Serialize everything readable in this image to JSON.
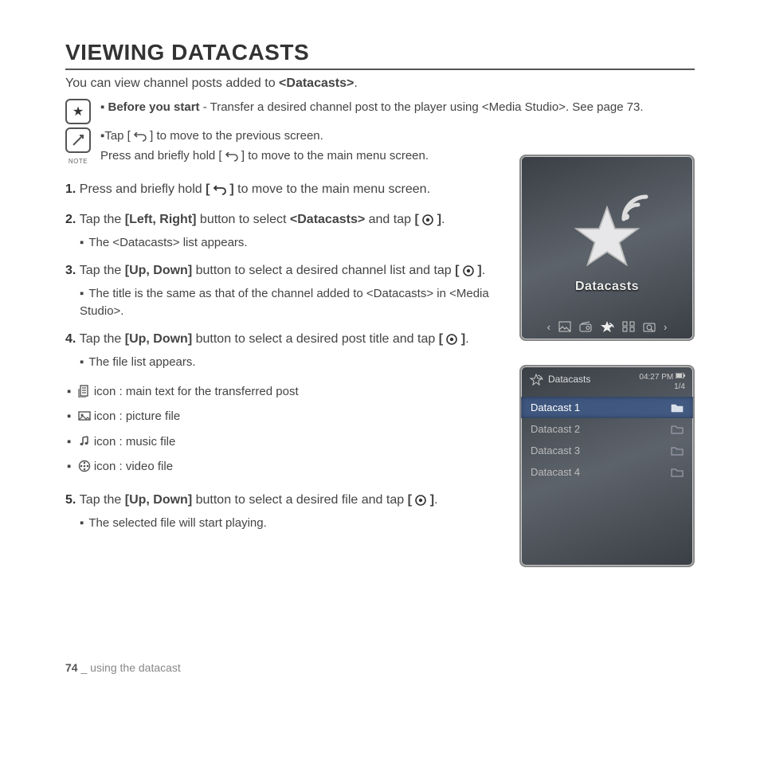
{
  "title": "VIEWING DATACASTS",
  "intro_pre": "You can view channel posts added to ",
  "intro_bold": "<Datacasts>",
  "intro_post": ".",
  "star_callout_bold": "Before you start",
  "star_callout_rest": " - Transfer a desired channel post to the player using <Media Studio>. See page 73.",
  "note_label": "NOTE",
  "note_line1_pre": "Tap [ ",
  "note_line1_post": " ] to move to the previous screen.",
  "note_line2_pre": "Press and briefly hold [ ",
  "note_line2_post": " ] to move to the main menu screen.",
  "steps": {
    "s1_pre": "Press and briefly hold ",
    "s1_b1": "[ ",
    "s1_b2": " ]",
    "s1_post": " to move to the main menu screen.",
    "s2_pre": "Tap the ",
    "s2_b1": "[Left, Right]",
    "s2_mid": " button to select ",
    "s2_b2": "<Datacasts>",
    "s2_mid2": " and tap ",
    "s2_b3": "[ ",
    "s2_b4": " ]",
    "s2_post": ".",
    "s2_sub": "The <Datacasts> list appears.",
    "s3_pre": "Tap the ",
    "s3_b1": "[Up, Down]",
    "s3_mid": " button to select a desired channel list and tap ",
    "s3_b2": "[ ",
    "s3_b3": " ]",
    "s3_post": ".",
    "s3_sub": "The title is the same as that of the channel added to <Datacasts> in <Media Studio>.",
    "s4_pre": "Tap the ",
    "s4_b1": "[Up, Down]",
    "s4_mid": " button to select a desired post title and tap ",
    "s4_b2": "[ ",
    "s4_b3": " ]",
    "s4_post": ".",
    "s4_sub": "The file list appears.",
    "s5_pre": "Tap the ",
    "s5_b1": "[Up, Down]",
    "s5_mid": " button to select a desired file and tap ",
    "s5_b2": "[ ",
    "s5_b3": " ]",
    "s5_post": ".",
    "s5_sub": "The selected file will start playing."
  },
  "legend": {
    "text": " icon : main text for the transferred post",
    "pic": " icon : picture file",
    "music": " icon : music file",
    "video": " icon : video file"
  },
  "screen1": {
    "label": "Datacasts"
  },
  "screen2": {
    "title": "Datacasts",
    "time": "04:27 PM",
    "page": "1/4",
    "items": [
      "Datacast 1",
      "Datacast 2",
      "Datacast 3",
      "Datacast 4"
    ]
  },
  "footer_page": "74",
  "footer_sep": " _ ",
  "footer_text": "using the datacast"
}
